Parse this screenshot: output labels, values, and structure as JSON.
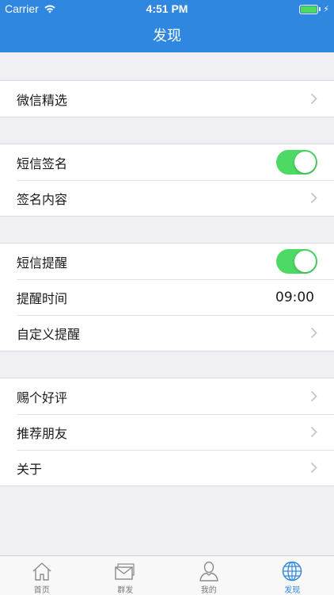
{
  "status_bar": {
    "carrier": "Carrier",
    "time": "4:51 PM",
    "wifi_icon": "wifi-icon",
    "battery_icon": "battery-icon",
    "charging_icon": "lightning-bolt-icon",
    "battery_level": 1.0
  },
  "nav": {
    "title": "发现"
  },
  "sections": [
    {
      "rows": [
        {
          "label": "微信精选",
          "accessory": "chevron"
        }
      ]
    },
    {
      "rows": [
        {
          "label": "短信签名",
          "accessory": "toggle",
          "on": true
        },
        {
          "label": "签名内容",
          "accessory": "chevron"
        }
      ]
    },
    {
      "rows": [
        {
          "label": "短信提醒",
          "accessory": "toggle",
          "on": true
        },
        {
          "label": "提醒时间",
          "accessory": "value",
          "value": "09:00"
        },
        {
          "label": "自定义提醒",
          "accessory": "chevron"
        }
      ]
    },
    {
      "rows": [
        {
          "label": "赐个好评",
          "accessory": "chevron"
        },
        {
          "label": "推荐朋友",
          "accessory": "chevron"
        },
        {
          "label": "关于",
          "accessory": "chevron"
        }
      ]
    }
  ],
  "tabs": [
    {
      "label": "首页",
      "icon": "home-icon",
      "active": false
    },
    {
      "label": "群发",
      "icon": "envelope-icon",
      "active": false
    },
    {
      "label": "我的",
      "icon": "person-icon",
      "active": false
    },
    {
      "label": "发现",
      "icon": "globe-icon",
      "active": true
    }
  ],
  "colors": {
    "nav_blue": "#2f87e0",
    "toggle_green": "#4cd964",
    "background": "#efeff4",
    "tab_inactive": "#7a7a7a"
  }
}
